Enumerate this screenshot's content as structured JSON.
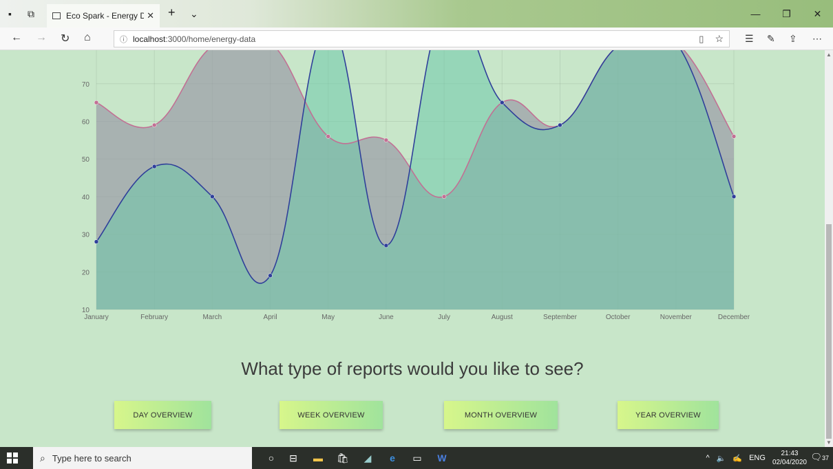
{
  "browser": {
    "tab_title": "Eco Spark - Energy Data",
    "url_host": "localhost",
    "url_path": ":3000/home/energy-data"
  },
  "chart_data": {
    "type": "area",
    "categories": [
      "January",
      "February",
      "March",
      "April",
      "May",
      "June",
      "July",
      "August",
      "September",
      "October",
      "November",
      "December"
    ],
    "series": [
      {
        "color": "#c27094",
        "fill": "rgba(150,150,165,0.65)",
        "values": [
          65,
          59,
          80,
          81,
          56,
          55,
          40,
          65,
          59,
          80,
          81,
          56
        ]
      },
      {
        "color": "#2f3f9a",
        "fill": "rgba(110,200,170,0.55)",
        "values": [
          28,
          48,
          40,
          19,
          86,
          27,
          90,
          65,
          59,
          80,
          81,
          40
        ]
      }
    ],
    "yticks": [
      10,
      20,
      30,
      40,
      50,
      60,
      70
    ],
    "ylim": [
      10,
      78
    ]
  },
  "heading": "What type of reports would you like to see?",
  "buttons": [
    "DAY OVERVIEW",
    "WEEK OVERVIEW",
    "MONTH OVERVIEW",
    "YEAR OVERVIEW"
  ],
  "taskbar": {
    "search_placeholder": "Type here to search",
    "lang": "ENG",
    "time": "21:43",
    "date": "02/04/2020",
    "notif_count": "37"
  }
}
